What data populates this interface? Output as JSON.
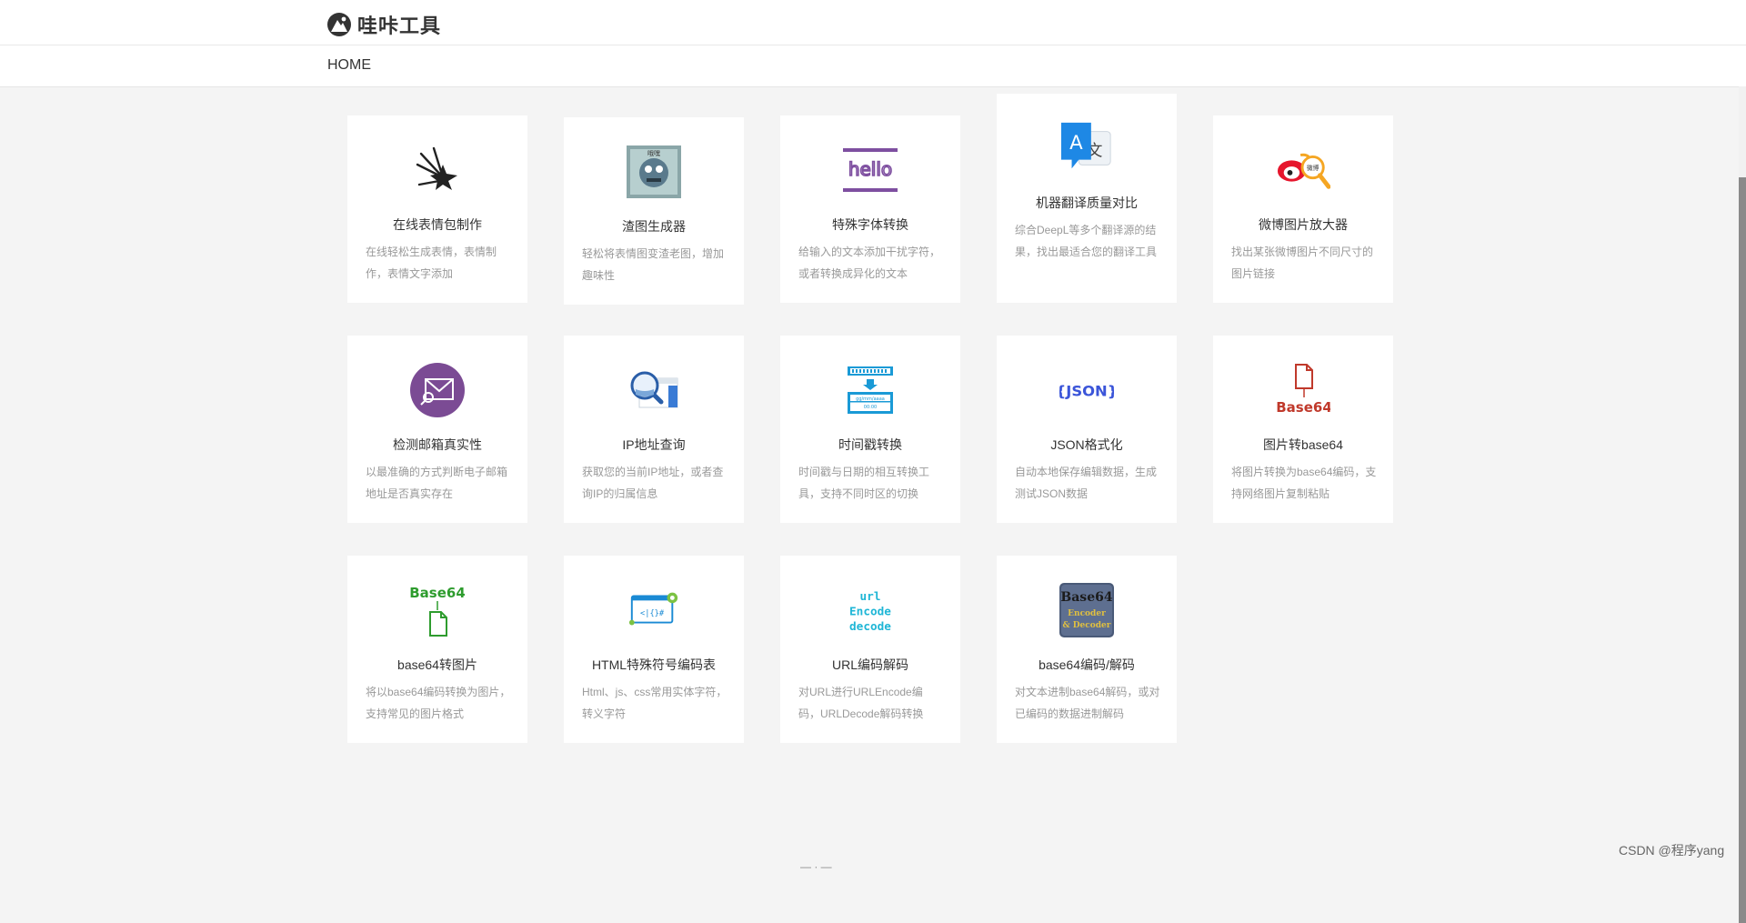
{
  "header": {
    "logo_text": "哇咔工具",
    "nav_home": "HOME"
  },
  "cards": [
    {
      "title": "在线表情包制作",
      "desc": "在线轻松生成表情，表情制作，表情文字添加",
      "icon": "spark-icon"
    },
    {
      "title": "渣图生成器",
      "desc": "轻松将表情图变渣老图，增加趣味性",
      "icon": "meme-image-icon"
    },
    {
      "title": "特殊字体转换",
      "desc": "给输入的文本添加干扰字符，或者转换成异化的文本",
      "icon": "hello-font-icon"
    },
    {
      "title": "机器翻译质量对比",
      "desc": "综合DeepL等多个翻译源的结果，找出最适合您的翻译工具",
      "icon": "translate-icon"
    },
    {
      "title": "微博图片放大器",
      "desc": "找出某张微博图片不同尺寸的图片链接",
      "icon": "weibo-magnifier-icon"
    },
    {
      "title": "检测邮箱真实性",
      "desc": "以最准确的方式判断电子邮箱地址是否真实存在",
      "icon": "mail-check-icon"
    },
    {
      "title": "IP地址查询",
      "desc": "获取您的当前IP地址，或者查询IP的归属信息",
      "icon": "ip-search-icon"
    },
    {
      "title": "时间戳转换",
      "desc": "时间戳与日期的相互转换工具，支持不同时区的切换",
      "icon": "timestamp-icon"
    },
    {
      "title": "JSON格式化",
      "desc": "自动本地保存编辑数据，生成测试JSON数据",
      "icon": "json-icon"
    },
    {
      "title": "图片转base64",
      "desc": "将图片转换为base64编码，支持网络图片复制粘贴",
      "icon": "image-to-base64-icon"
    },
    {
      "title": "base64转图片",
      "desc": "将以base64编码转换为图片，支持常见的图片格式",
      "icon": "base64-to-image-icon"
    },
    {
      "title": "HTML特殊符号编码表",
      "desc": "Html、js、css常用实体字符，转义字符",
      "icon": "html-code-icon"
    },
    {
      "title": "URL编码解码",
      "desc": "对URL进行URLEncode编码，URLDecode解码转换",
      "icon": "url-encode-icon"
    },
    {
      "title": "base64编码/解码",
      "desc": "对文本进制base64解码，或对已编码的数据进制解码",
      "icon": "base64-codec-icon"
    }
  ],
  "icon_text": {
    "hello": "hello",
    "json": "{JSON}",
    "base64": "Base64",
    "url_lines": [
      "url",
      "Encode",
      "decode"
    ],
    "b64_box": [
      "Base64",
      "Encoder",
      "& Decoder"
    ],
    "html_code": "<|{}#",
    "weibo": "微博"
  },
  "watermark": "CSDN @程序yang",
  "footer_fragment": "— · —"
}
